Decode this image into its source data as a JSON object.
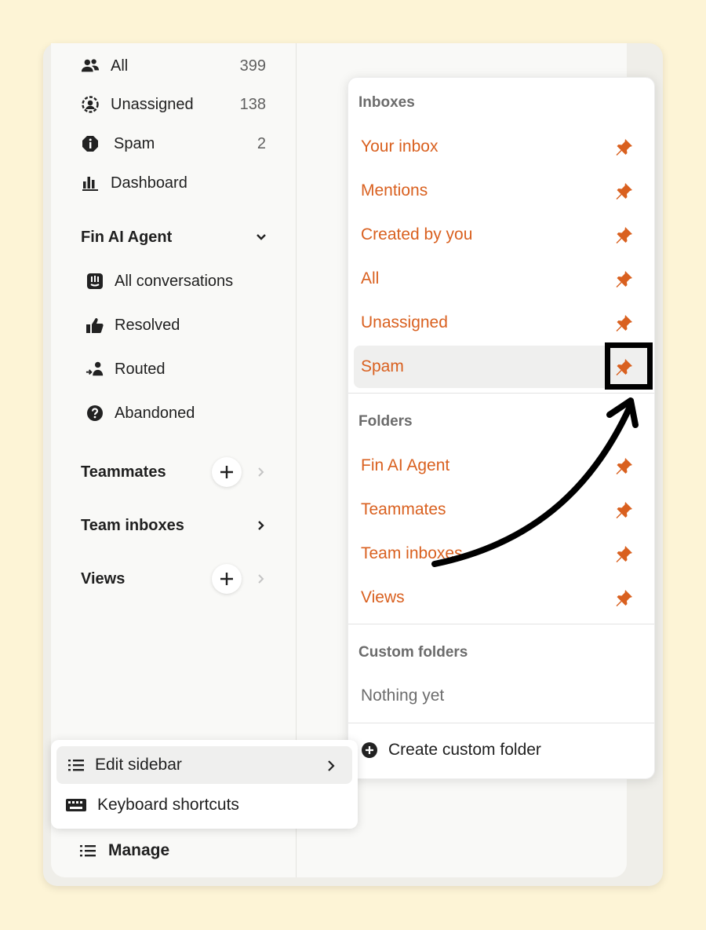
{
  "sidebar": {
    "items": [
      {
        "label": "All",
        "count": "399",
        "icon": "people-icon"
      },
      {
        "label": "Unassigned",
        "count": "138",
        "icon": "unassigned-icon"
      },
      {
        "label": "Spam",
        "count": "2",
        "icon": "spam-icon"
      },
      {
        "label": "Dashboard",
        "count": "",
        "icon": "bar-chart-icon"
      }
    ],
    "fin_section": {
      "title": "Fin AI Agent",
      "items": [
        {
          "label": "All conversations",
          "icon": "fin-icon"
        },
        {
          "label": "Resolved",
          "icon": "thumbs-up-icon"
        },
        {
          "label": "Routed",
          "icon": "routed-icon"
        },
        {
          "label": "Abandoned",
          "icon": "question-icon"
        }
      ]
    },
    "teammates": "Teammates",
    "team_inboxes": "Team inboxes",
    "views": "Views"
  },
  "popup": {
    "inboxes_heading": "Inboxes",
    "inboxes": [
      "Your inbox",
      "Mentions",
      "Created by you",
      "All",
      "Unassigned",
      "Spam"
    ],
    "folders_heading": "Folders",
    "folders": [
      "Fin AI Agent",
      "Teammates",
      "Team inboxes",
      "Views"
    ],
    "custom_heading": "Custom folders",
    "empty_text": "Nothing yet",
    "create_label": "Create custom folder"
  },
  "menu": {
    "edit_sidebar": "Edit sidebar",
    "keyboard_shortcuts": "Keyboard shortcuts"
  },
  "manage": "Manage",
  "colors": {
    "accent": "#d9601f",
    "background": "#fdf4d6"
  }
}
